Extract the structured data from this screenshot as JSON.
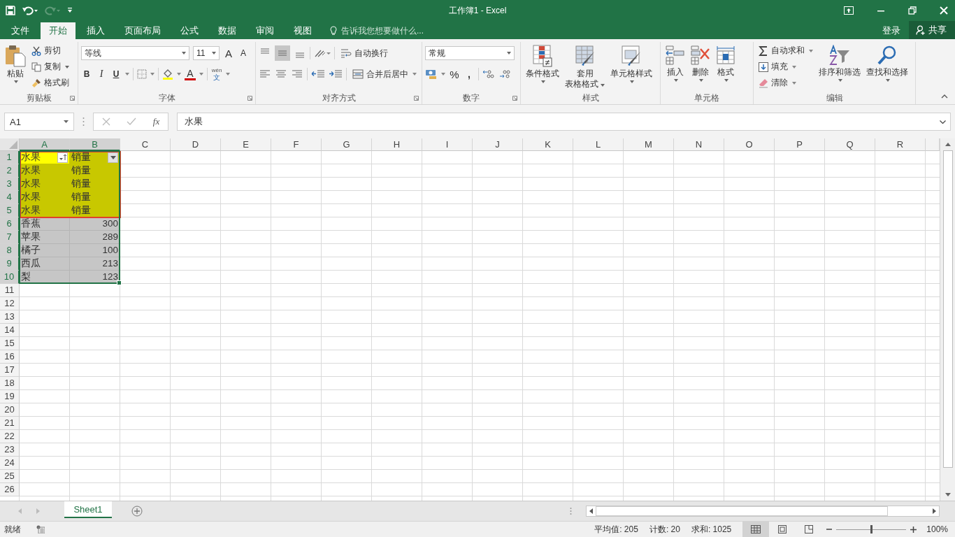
{
  "title_bar": {
    "title": "工作簿1 - Excel"
  },
  "tabs": [
    {
      "label": "文件",
      "selected": false
    },
    {
      "label": "开始",
      "selected": true
    },
    {
      "label": "插入",
      "selected": false
    },
    {
      "label": "页面布局",
      "selected": false
    },
    {
      "label": "公式",
      "selected": false
    },
    {
      "label": "数据",
      "selected": false
    },
    {
      "label": "审阅",
      "selected": false
    },
    {
      "label": "视图",
      "selected": false
    }
  ],
  "tell_me": {
    "placeholder": "告诉我您想要做什么..."
  },
  "account": {
    "sign_in": "登录",
    "share": "共享"
  },
  "ribbon": {
    "clipboard": {
      "label": "剪贴板",
      "paste": "粘贴",
      "cut": "剪切",
      "copy": "复制",
      "format_painter": "格式刷"
    },
    "font": {
      "label": "字体",
      "font_name": "等线",
      "font_size": "11",
      "grow": "A",
      "shrink": "A",
      "bold": "B",
      "italic": "I",
      "underline": "U",
      "font_color": "A",
      "phonetic_top": "wén",
      "phonetic_bottom": "文"
    },
    "alignment": {
      "label": "对齐方式",
      "wrap": "自动换行",
      "merge": "合并后居中"
    },
    "number": {
      "label": "数字",
      "format": "常规",
      "percent": "%",
      "comma": ","
    },
    "styles": {
      "label": "样式",
      "conditional": "条件格式",
      "table_top": "套用",
      "table_bottom": "表格格式",
      "cell_styles": "单元格样式"
    },
    "cells": {
      "label": "单元格",
      "insert": "插入",
      "delete": "删除",
      "format": "格式"
    },
    "editing": {
      "label": "编辑",
      "autosum": "自动求和",
      "fill": "填充",
      "clear": "清除",
      "sort": "排序和筛选",
      "find": "查找和选择"
    }
  },
  "formula_bar": {
    "name_box": "A1",
    "function_label": "fx",
    "value": "水果"
  },
  "sheet": {
    "columns": [
      {
        "label": "A",
        "selected": true
      },
      {
        "label": "B",
        "selected": true
      },
      {
        "label": "C",
        "selected": false
      },
      {
        "label": "D",
        "selected": false
      },
      {
        "label": "E",
        "selected": false
      },
      {
        "label": "F",
        "selected": false
      },
      {
        "label": "G",
        "selected": false
      },
      {
        "label": "H",
        "selected": false
      },
      {
        "label": "I",
        "selected": false
      },
      {
        "label": "J",
        "selected": false
      },
      {
        "label": "K",
        "selected": false
      },
      {
        "label": "L",
        "selected": false
      },
      {
        "label": "M",
        "selected": false
      },
      {
        "label": "N",
        "selected": false
      },
      {
        "label": "O",
        "selected": false
      },
      {
        "label": "P",
        "selected": false
      },
      {
        "label": "Q",
        "selected": false
      },
      {
        "label": "R",
        "selected": false
      }
    ],
    "rows": [
      {
        "label": "1",
        "selected": true,
        "highlighted": true,
        "cells": [
          {
            "text": "水果",
            "kind": "text",
            "active": true,
            "filter": {
              "kind": "sorted"
            }
          },
          {
            "text": "销量",
            "kind": "text",
            "active": false,
            "filter": {
              "kind": "dropdown"
            }
          }
        ]
      },
      {
        "label": "2",
        "selected": true,
        "highlighted": true,
        "cells": [
          {
            "text": "水果",
            "kind": "text",
            "active": false
          },
          {
            "text": "销量",
            "kind": "text",
            "active": false
          }
        ]
      },
      {
        "label": "3",
        "selected": true,
        "highlighted": true,
        "cells": [
          {
            "text": "水果",
            "kind": "text",
            "active": false
          },
          {
            "text": "销量",
            "kind": "text",
            "active": false
          }
        ]
      },
      {
        "label": "4",
        "selected": true,
        "highlighted": true,
        "cells": [
          {
            "text": "水果",
            "kind": "text",
            "active": false
          },
          {
            "text": "销量",
            "kind": "text",
            "active": false
          }
        ]
      },
      {
        "label": "5",
        "selected": true,
        "highlighted": true,
        "cells": [
          {
            "text": "水果",
            "kind": "text",
            "active": false
          },
          {
            "text": "销量",
            "kind": "text",
            "active": false
          }
        ]
      },
      {
        "label": "6",
        "selected": true,
        "highlighted": false,
        "cells": [
          {
            "text": "香蕉",
            "kind": "text",
            "active": false
          },
          {
            "text": "300",
            "kind": "number",
            "active": false
          }
        ]
      },
      {
        "label": "7",
        "selected": true,
        "highlighted": false,
        "cells": [
          {
            "text": "苹果",
            "kind": "text",
            "active": false
          },
          {
            "text": "289",
            "kind": "number",
            "active": false
          }
        ]
      },
      {
        "label": "8",
        "selected": true,
        "highlighted": false,
        "cells": [
          {
            "text": "橘子",
            "kind": "text",
            "active": false
          },
          {
            "text": "100",
            "kind": "number",
            "active": false
          }
        ]
      },
      {
        "label": "9",
        "selected": true,
        "highlighted": false,
        "cells": [
          {
            "text": "西瓜",
            "kind": "text",
            "active": false
          },
          {
            "text": "213",
            "kind": "number",
            "active": false
          }
        ]
      },
      {
        "label": "10",
        "selected": true,
        "highlighted": false,
        "cells": [
          {
            "text": "梨",
            "kind": "text",
            "active": false
          },
          {
            "text": "123",
            "kind": "number",
            "active": false
          }
        ]
      },
      {
        "label": "11",
        "selected": false
      },
      {
        "label": "12",
        "selected": false
      },
      {
        "label": "13",
        "selected": false
      },
      {
        "label": "14",
        "selected": false
      },
      {
        "label": "15",
        "selected": false
      },
      {
        "label": "16",
        "selected": false
      },
      {
        "label": "17",
        "selected": false
      },
      {
        "label": "18",
        "selected": false
      },
      {
        "label": "19",
        "selected": false
      },
      {
        "label": "20",
        "selected": false
      },
      {
        "label": "21",
        "selected": false
      },
      {
        "label": "22",
        "selected": false
      },
      {
        "label": "23",
        "selected": false
      },
      {
        "label": "24",
        "selected": false
      },
      {
        "label": "25",
        "selected": false
      },
      {
        "label": "26",
        "selected": false
      }
    ]
  },
  "sheet_tabs": [
    {
      "label": "Sheet1",
      "selected": true
    }
  ],
  "status_bar": {
    "status": "就绪",
    "stats": [
      "平均值: 205",
      "计数: 20",
      "求和: 1025"
    ],
    "views": [
      {
        "kind": "normal",
        "selected": true
      },
      {
        "kind": "page_layout",
        "selected": false
      },
      {
        "kind": "page_break",
        "selected": false
      }
    ],
    "zoom": {
      "level": 0.5,
      "reading": "100%"
    }
  }
}
